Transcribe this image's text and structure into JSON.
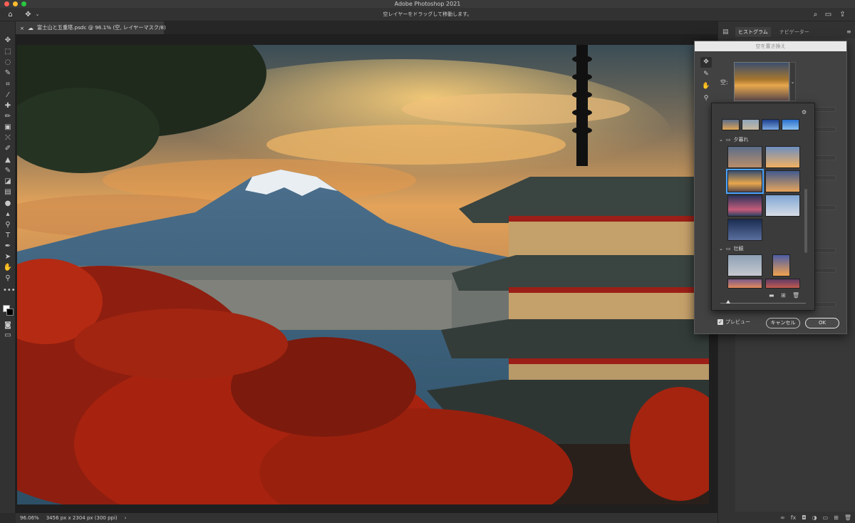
{
  "window": {
    "title": "Adobe Photoshop 2021"
  },
  "options_bar": {
    "hint": "空レイヤーをドラッグして移動します。"
  },
  "document": {
    "tab_title": "富士山と五重塔.psdc @ 96.1% (空, レイヤーマスク/8)",
    "close_glyph": "×"
  },
  "status": {
    "zoom": "96.06%",
    "dimensions": "3456 px x 2304 px (300 ppi)",
    "arrow": "›"
  },
  "panels": {
    "tabs": [
      "ヒストグラム",
      "ナビゲーター"
    ]
  },
  "sky_dialog": {
    "title": "空を置き換え",
    "sky_label": "空:",
    "preview_label": "プレビュー",
    "cancel_label": "キャンセル",
    "ok_label": "OK"
  },
  "sky_presets": {
    "groups": [
      {
        "name": "夕暮れ"
      },
      {
        "name": "壮観"
      }
    ]
  },
  "colors": {
    "accent": "#4aa3ff",
    "ui_bg": "#323232",
    "dialog_bg": "#424242"
  },
  "icons": [
    "home-icon",
    "move-icon",
    "search-icon",
    "workspace-icon",
    "share-icon",
    "folder-icon",
    "new-sky-icon",
    "trash-icon",
    "gear-icon",
    "brush-icon",
    "hand-icon",
    "zoom-icon"
  ]
}
